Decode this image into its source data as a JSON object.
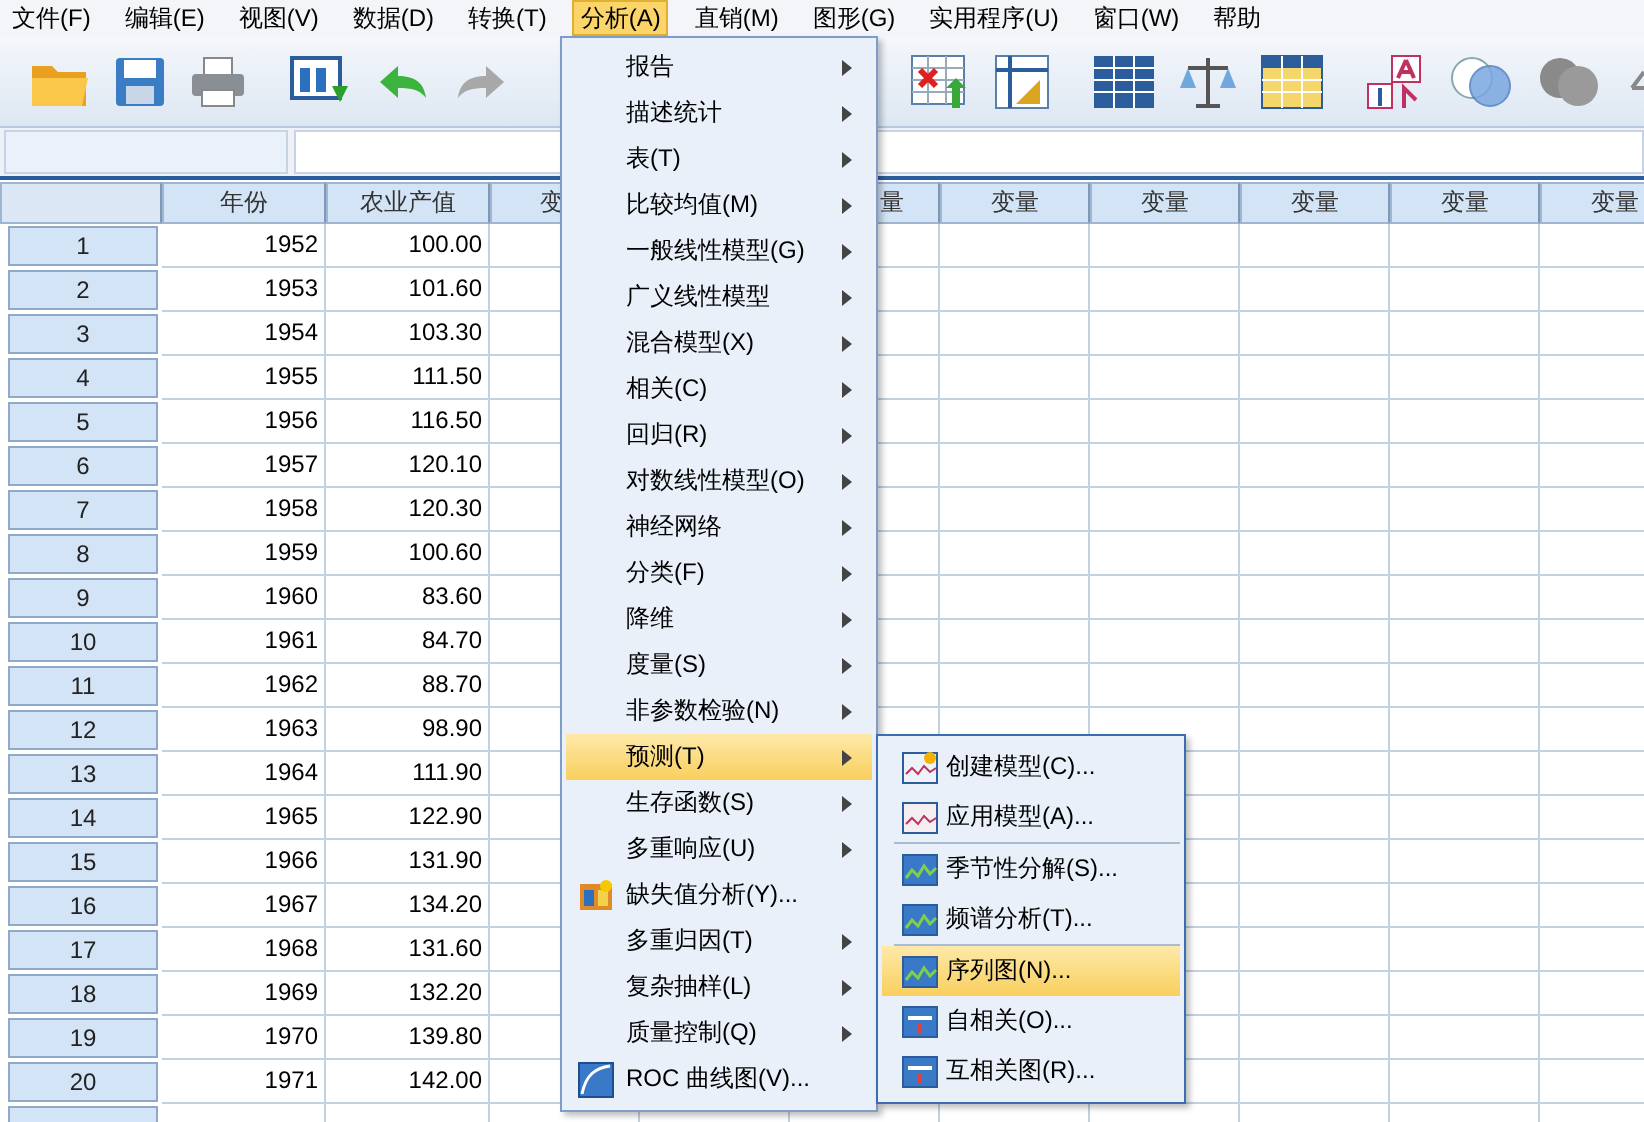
{
  "menubar": [
    {
      "label": "文件(F)",
      "selected": false
    },
    {
      "label": "编辑(E)",
      "selected": false
    },
    {
      "label": "视图(V)",
      "selected": false
    },
    {
      "label": "数据(D)",
      "selected": false
    },
    {
      "label": "转换(T)",
      "selected": false
    },
    {
      "label": "分析(A)",
      "selected": true
    },
    {
      "label": "直销(M)",
      "selected": false
    },
    {
      "label": "图形(G)",
      "selected": false
    },
    {
      "label": "实用程序(U)",
      "selected": false
    },
    {
      "label": "窗口(W)",
      "selected": false
    },
    {
      "label": "帮助",
      "selected": false
    }
  ],
  "table": {
    "columns": [
      {},
      {
        "label": "年份"
      },
      {
        "label": "农业产值"
      },
      {
        "label": "变",
        "cut_end": true
      },
      {},
      {
        "label": "量",
        "cut_start": true
      },
      {
        "label": "变量"
      },
      {
        "label": "变量"
      },
      {
        "label": "变量"
      },
      {
        "label": "变量"
      },
      {
        "label": "变量"
      }
    ],
    "rows": [
      [
        "1",
        "1952",
        "100.00"
      ],
      [
        "2",
        "1953",
        "101.60"
      ],
      [
        "3",
        "1954",
        "103.30"
      ],
      [
        "4",
        "1955",
        "111.50"
      ],
      [
        "5",
        "1956",
        "116.50"
      ],
      [
        "6",
        "1957",
        "120.10"
      ],
      [
        "7",
        "1958",
        "120.30"
      ],
      [
        "8",
        "1959",
        "100.60"
      ],
      [
        "9",
        "1960",
        "83.60"
      ],
      [
        "10",
        "1961",
        "84.70"
      ],
      [
        "11",
        "1962",
        "88.70"
      ],
      [
        "12",
        "1963",
        "98.90"
      ],
      [
        "13",
        "1964",
        "111.90"
      ],
      [
        "14",
        "1965",
        "122.90"
      ],
      [
        "15",
        "1966",
        "131.90"
      ],
      [
        "16",
        "1967",
        "134.20"
      ],
      [
        "17",
        "1968",
        "131.60"
      ],
      [
        "18",
        "1969",
        "132.20"
      ],
      [
        "19",
        "1970",
        "139.80"
      ],
      [
        "20",
        "1971",
        "142.00"
      ]
    ]
  },
  "menu": [
    {
      "label": "报告",
      "kind": "submenu",
      "selected": false
    },
    {
      "label": "描述统计",
      "kind": "submenu",
      "selected": false
    },
    {
      "label": "表(T)",
      "kind": "submenu",
      "selected": false
    },
    {
      "label": "比较均值(M)",
      "kind": "submenu",
      "selected": false
    },
    {
      "label": "一般线性模型(G)",
      "kind": "submenu",
      "selected": false
    },
    {
      "label": "广义线性模型",
      "kind": "submenu",
      "selected": false
    },
    {
      "label": "混合模型(X)",
      "kind": "submenu",
      "selected": false
    },
    {
      "label": "相关(C)",
      "kind": "submenu",
      "selected": false
    },
    {
      "label": "回归(R)",
      "kind": "submenu",
      "selected": false
    },
    {
      "label": "对数线性模型(O)",
      "kind": "submenu",
      "selected": false
    },
    {
      "label": "神经网络",
      "kind": "submenu",
      "selected": false
    },
    {
      "label": "分类(F)",
      "kind": "submenu",
      "selected": false
    },
    {
      "label": "降维",
      "kind": "submenu",
      "selected": false
    },
    {
      "label": "度量(S)",
      "kind": "submenu",
      "selected": false
    },
    {
      "label": "非参数检验(N)",
      "kind": "submenu",
      "selected": false
    },
    {
      "label": "预测(T)",
      "kind": "submenu",
      "selected": true
    },
    {
      "label": "生存函数(S)",
      "kind": "submenu",
      "selected": false
    },
    {
      "label": "多重响应(U)",
      "kind": "submenu",
      "selected": false
    },
    {
      "label": "缺失值分析(Y)...",
      "kind": "missing",
      "selected": false
    },
    {
      "label": "多重归因(T)",
      "kind": "submenu",
      "selected": false
    },
    {
      "label": "复杂抽样(L)",
      "kind": "submenu",
      "selected": false
    },
    {
      "label": "质量控制(Q)",
      "kind": "submenu",
      "selected": false
    },
    {
      "label": "ROC 曲线图(V)...",
      "kind": "roc",
      "selected": false
    }
  ],
  "submenu": [
    {
      "label": "创建模型(C)...",
      "kind": "create",
      "selected": false
    },
    {
      "label": "应用模型(A)...",
      "kind": "apply",
      "selected": false
    },
    {
      "kind": "separator"
    },
    {
      "label": "季节性分解(S)...",
      "kind": "seasonal",
      "selected": false
    },
    {
      "label": "频谱分析(T)...",
      "kind": "spectral",
      "selected": false
    },
    {
      "kind": "separator"
    },
    {
      "label": "序列图(N)...",
      "kind": "sequence",
      "selected": true
    },
    {
      "label": "自相关(O)...",
      "kind": "autocorr",
      "selected": false
    },
    {
      "label": "互相关图(R)...",
      "kind": "crosscorr",
      "selected": false
    }
  ]
}
